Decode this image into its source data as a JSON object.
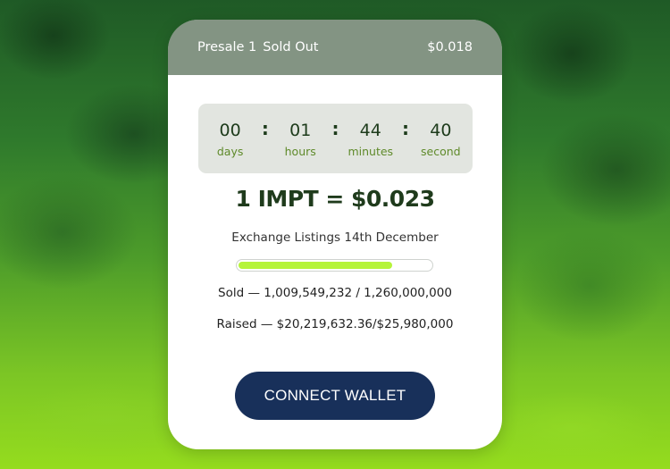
{
  "header": {
    "presale_label": "Presale 1",
    "status": "Sold Out",
    "presale_price": "$0.018"
  },
  "countdown": {
    "days": {
      "value": "00",
      "label": "days"
    },
    "hours": {
      "value": "01",
      "label": "hours"
    },
    "minutes": {
      "value": "44",
      "label": "minutes"
    },
    "seconds": {
      "value": "40",
      "label": "second"
    },
    "separator": ":"
  },
  "price_line": "1 IMPT = $0.023",
  "listing_text": "Exchange Listings 14th December",
  "progress": {
    "fraction": 0.8
  },
  "sold_text": "Sold — 1,009,549,232 / 1,260,000,000",
  "raised_text": "Raised — $20,219,632.36/$25,980,000",
  "connect_button": "CONNECT WALLET",
  "colors": {
    "button_bg": "#18305a",
    "progress_fill": "#b5f43a",
    "countdown_label": "#5f8a2a",
    "heading_text": "#1f3b1c"
  }
}
